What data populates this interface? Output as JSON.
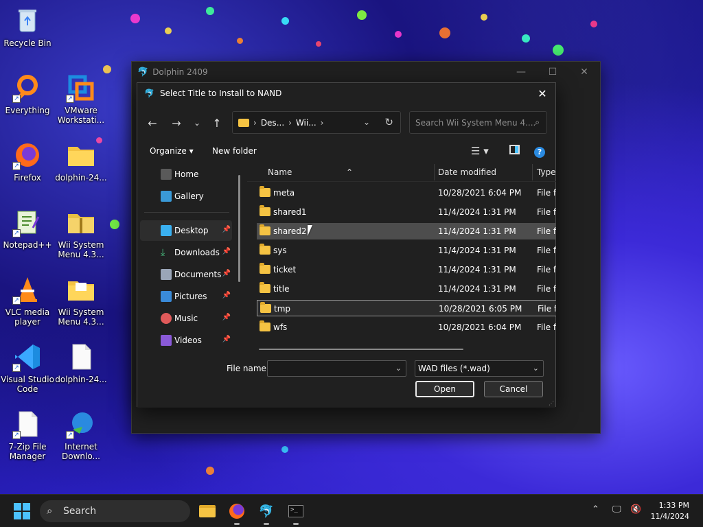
{
  "desktop": {
    "icons": [
      {
        "label": "Recycle Bin",
        "icon": "recycle-bin-icon"
      },
      {
        "label": "Everything",
        "icon": "everything-icon"
      },
      {
        "label": "VMware Workstati...",
        "icon": "vmware-icon"
      },
      {
        "label": "Firefox",
        "icon": "firefox-icon"
      },
      {
        "label": "dolphin-24...",
        "icon": "folder-icon"
      },
      {
        "label": "Notepad++",
        "icon": "notepadpp-icon"
      },
      {
        "label": "Wii System Menu 4.3...",
        "icon": "archive-icon"
      },
      {
        "label": "VLC media player",
        "icon": "vlc-icon"
      },
      {
        "label": "Wii System Menu 4.3...",
        "icon": "folder-icon"
      },
      {
        "label": "Visual Studio Code",
        "icon": "vscode-icon"
      },
      {
        "label": "dolphin-24...",
        "icon": "file-icon"
      },
      {
        "label": "7-Zip File Manager",
        "icon": "file-icon"
      },
      {
        "label": "Internet Downlo...",
        "icon": "idm-icon"
      }
    ]
  },
  "parent_window": {
    "title": "Dolphin 2409",
    "controls": {
      "minimize": "—",
      "maximize": "☐",
      "close": "✕"
    }
  },
  "dialog": {
    "title": "Select Title to Install to NAND",
    "close": "✕",
    "nav": {
      "back": "←",
      "forward": "→",
      "recent": "⌄",
      "up": "↑"
    },
    "address": {
      "seg1": "Des...",
      "seg2": "Wii...",
      "sep": "›"
    },
    "search_placeholder": "Search Wii System Menu 4....",
    "toolbar": {
      "organize": "Organize ▾",
      "new_folder": "New folder"
    },
    "nav_items": [
      {
        "label": "Home",
        "pinned": false
      },
      {
        "label": "Gallery",
        "pinned": false
      },
      {
        "label": "Desktop",
        "pinned": true
      },
      {
        "label": "Downloads",
        "pinned": true
      },
      {
        "label": "Documents",
        "pinned": true
      },
      {
        "label": "Pictures",
        "pinned": true
      },
      {
        "label": "Music",
        "pinned": true
      },
      {
        "label": "Videos",
        "pinned": true
      }
    ],
    "columns": {
      "name": "Name",
      "date": "Date modified",
      "type": "Type"
    },
    "files": [
      {
        "name": "meta",
        "date": "10/28/2021 6:04 PM",
        "type": "File fo"
      },
      {
        "name": "shared1",
        "date": "11/4/2024 1:31 PM",
        "type": "File fo"
      },
      {
        "name": "shared2",
        "date": "11/4/2024 1:31 PM",
        "type": "File fo"
      },
      {
        "name": "sys",
        "date": "11/4/2024 1:31 PM",
        "type": "File fo"
      },
      {
        "name": "ticket",
        "date": "11/4/2024 1:31 PM",
        "type": "File fo"
      },
      {
        "name": "title",
        "date": "11/4/2024 1:31 PM",
        "type": "File fo"
      },
      {
        "name": "tmp",
        "date": "10/28/2021 6:05 PM",
        "type": "File fo"
      },
      {
        "name": "wfs",
        "date": "10/28/2021 6:04 PM",
        "type": "File fo"
      }
    ],
    "file_name_label": "File name:",
    "file_name_value": "",
    "file_type": "WAD files (*.wad)",
    "open": "Open",
    "cancel": "Cancel"
  },
  "taskbar": {
    "search": "Search",
    "time": "1:33 PM",
    "date": "11/4/2024"
  },
  "colors": {
    "accent": "#4cc2ff",
    "folder": "#f5c343",
    "window_bg": "#202020"
  }
}
